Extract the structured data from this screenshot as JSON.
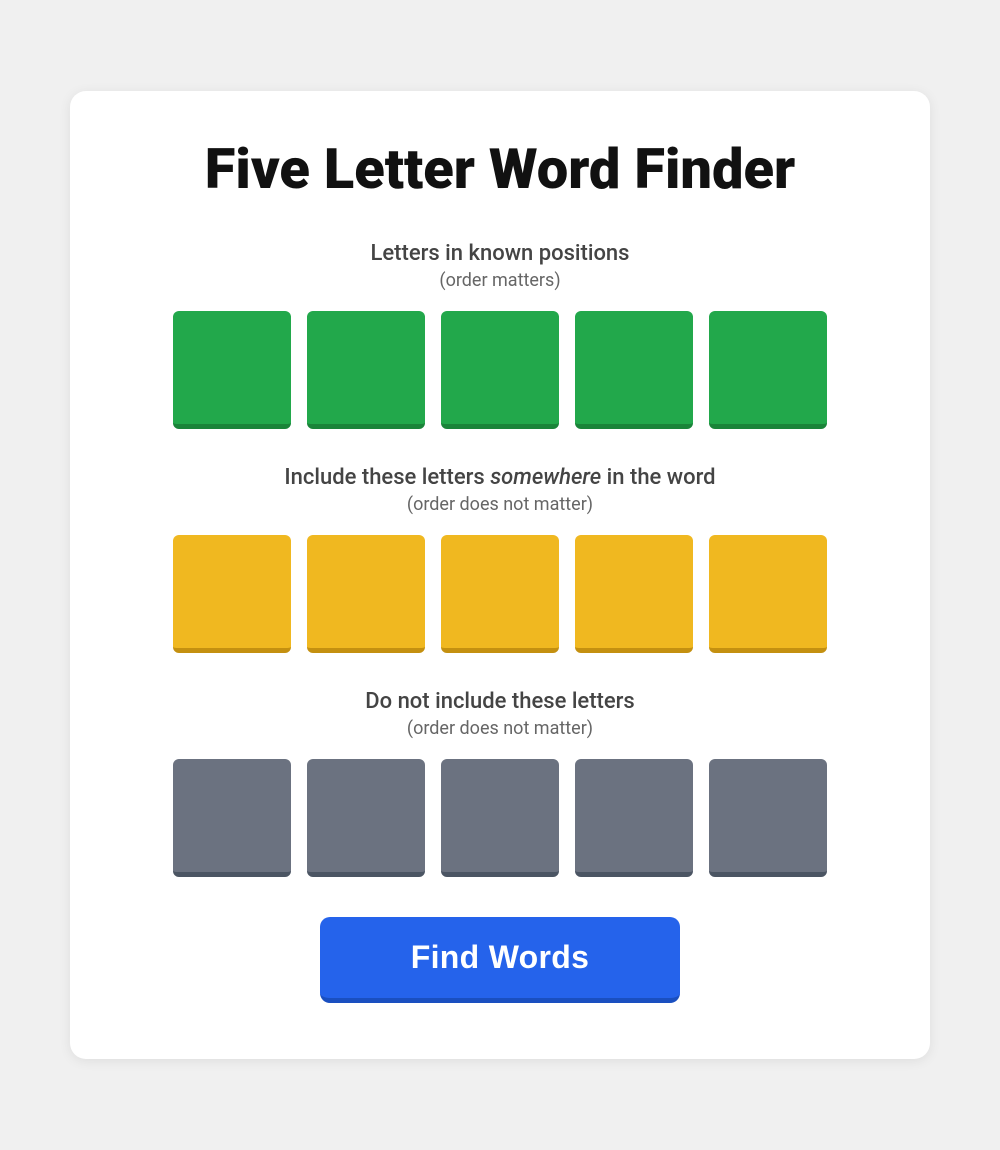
{
  "page": {
    "title": "Five Letter Word Finder"
  },
  "sections": {
    "known": {
      "label": "Letters in known positions",
      "sublabel": "(order matters)",
      "tiles": [
        {
          "id": "k1",
          "color": "green"
        },
        {
          "id": "k2",
          "color": "green"
        },
        {
          "id": "k3",
          "color": "green"
        },
        {
          "id": "k4",
          "color": "green"
        },
        {
          "id": "k5",
          "color": "green"
        }
      ]
    },
    "include": {
      "label_before": "Include these letters ",
      "label_em": "somewhere",
      "label_after": " in the word",
      "sublabel": "(order does not matter)",
      "tiles": [
        {
          "id": "i1",
          "color": "yellow"
        },
        {
          "id": "i2",
          "color": "yellow"
        },
        {
          "id": "i3",
          "color": "yellow"
        },
        {
          "id": "i4",
          "color": "yellow"
        },
        {
          "id": "i5",
          "color": "yellow"
        }
      ]
    },
    "exclude": {
      "label": "Do not include these letters",
      "sublabel": "(order does not matter)",
      "tiles": [
        {
          "id": "e1",
          "color": "gray"
        },
        {
          "id": "e2",
          "color": "gray"
        },
        {
          "id": "e3",
          "color": "gray"
        },
        {
          "id": "e4",
          "color": "gray"
        },
        {
          "id": "e5",
          "color": "gray"
        }
      ]
    }
  },
  "button": {
    "label": "Find Words"
  }
}
